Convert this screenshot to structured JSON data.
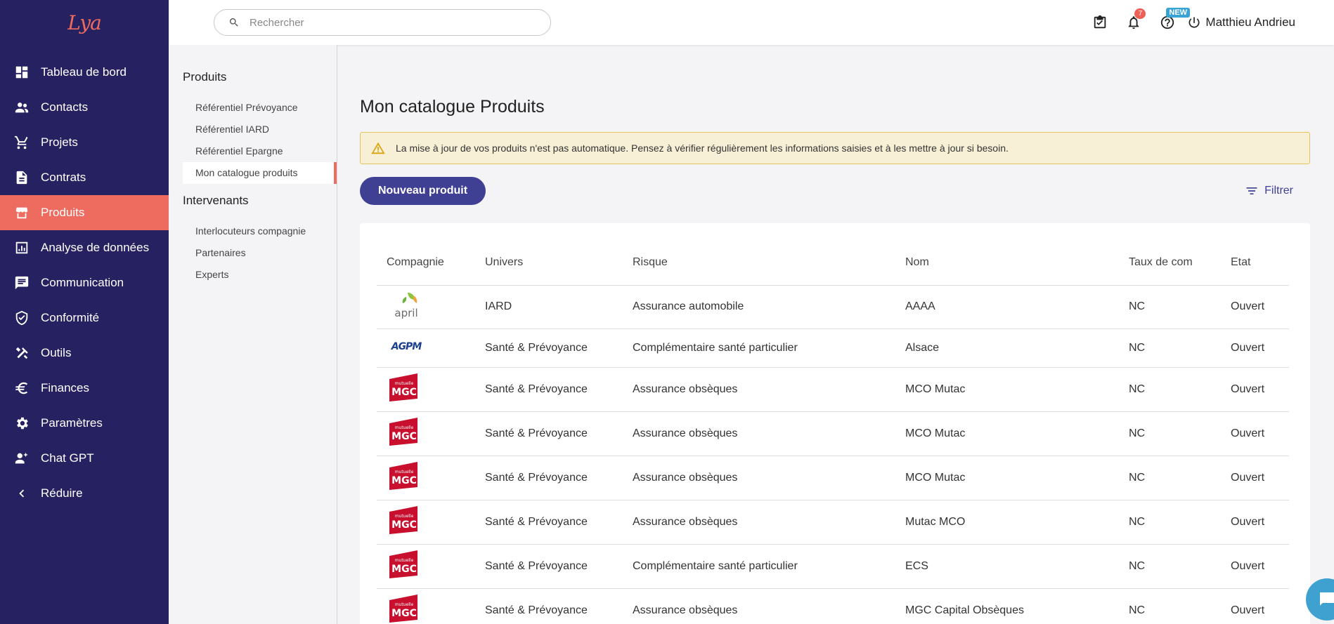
{
  "brand": {
    "logo": "Lya"
  },
  "sidebar": {
    "items": [
      {
        "label": "Tableau de bord",
        "icon": "dashboard-icon"
      },
      {
        "label": "Contacts",
        "icon": "people-icon"
      },
      {
        "label": "Projets",
        "icon": "cart-icon"
      },
      {
        "label": "Contrats",
        "icon": "document-icon"
      },
      {
        "label": "Produits",
        "icon": "store-icon",
        "active": true
      },
      {
        "label": "Analyse de données",
        "icon": "chart-icon"
      },
      {
        "label": "Communication",
        "icon": "message-icon"
      },
      {
        "label": "Conformité",
        "icon": "shield-icon"
      },
      {
        "label": "Outils",
        "icon": "tools-icon"
      },
      {
        "label": "Finances",
        "icon": "euro-icon"
      },
      {
        "label": "Paramètres",
        "icon": "gear-icon"
      },
      {
        "label": "Chat GPT",
        "icon": "chatgpt-icon"
      },
      {
        "label": "Réduire",
        "icon": "chevron-left-icon"
      }
    ]
  },
  "topbar": {
    "search_placeholder": "Rechercher",
    "notifications_count": "7",
    "new_label": "NEW",
    "user_name": "Matthieu Andrieu"
  },
  "subnav": {
    "section1": "Produits",
    "items1": [
      "Référentiel Prévoyance",
      "Référentiel IARD",
      "Référentiel Epargne",
      "Mon catalogue produits"
    ],
    "section2": "Intervenants",
    "items2": [
      "Interlocuteurs compagnie",
      "Partenaires",
      "Experts"
    ]
  },
  "main": {
    "title": "Mon catalogue Produits",
    "warning": "La mise à jour de vos produits n'est pas automatique. Pensez à vérifier régulièrement les informations saisies et à les mettre à jour si besoin.",
    "new_button": "Nouveau produit",
    "filter_label": "Filtrer"
  },
  "table": {
    "headers": [
      "Compagnie",
      "Univers",
      "Risque",
      "Nom",
      "Taux de com",
      "Etat"
    ],
    "rows": [
      {
        "logo": "april",
        "univers": "IARD",
        "risque": "Assurance automobile",
        "nom": "AAAA",
        "taux": "NC",
        "etat": "Ouvert"
      },
      {
        "logo": "AGPM",
        "univers": "Santé & Prévoyance",
        "risque": "Complémentaire santé particulier",
        "nom": "Alsace",
        "taux": "NC",
        "etat": "Ouvert"
      },
      {
        "logo": "MGC",
        "univers": "Santé & Prévoyance",
        "risque": "Assurance obsèques",
        "nom": "MCO Mutac",
        "taux": "NC",
        "etat": "Ouvert"
      },
      {
        "logo": "MGC",
        "univers": "Santé & Prévoyance",
        "risque": "Assurance obsèques",
        "nom": "MCO Mutac",
        "taux": "NC",
        "etat": "Ouvert"
      },
      {
        "logo": "MGC",
        "univers": "Santé & Prévoyance",
        "risque": "Assurance obsèques",
        "nom": "MCO Mutac",
        "taux": "NC",
        "etat": "Ouvert"
      },
      {
        "logo": "MGC",
        "univers": "Santé & Prévoyance",
        "risque": "Assurance obsèques",
        "nom": "Mutac MCO",
        "taux": "NC",
        "etat": "Ouvert"
      },
      {
        "logo": "MGC",
        "univers": "Santé & Prévoyance",
        "risque": "Complémentaire santé particulier",
        "nom": "ECS",
        "taux": "NC",
        "etat": "Ouvert"
      },
      {
        "logo": "MGC",
        "univers": "Santé & Prévoyance",
        "risque": "Assurance obsèques",
        "nom": "MGC Capital Obsèques",
        "taux": "NC",
        "etat": "Ouvert"
      }
    ]
  },
  "colors": {
    "sidebar": "#262261",
    "accent": "#ee6b5f",
    "primary": "#3f3f94"
  }
}
